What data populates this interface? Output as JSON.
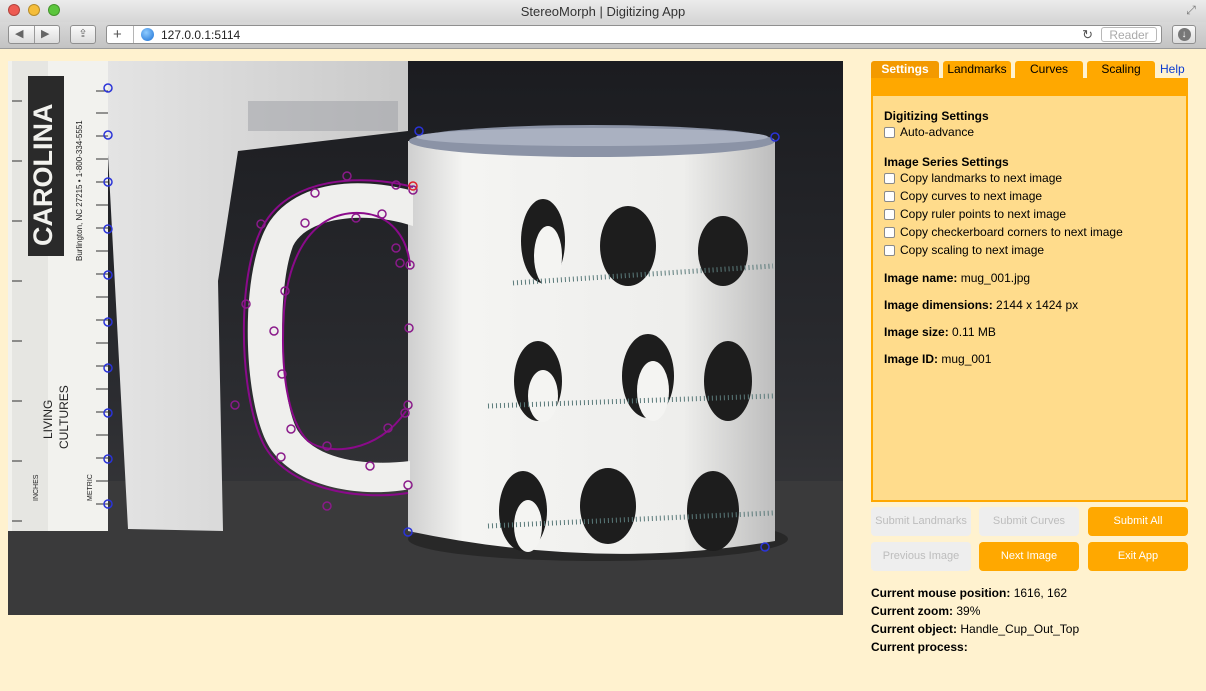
{
  "window": {
    "title": "StereoMorph | Digitizing App"
  },
  "browser": {
    "url": "127.0.0.1:5114",
    "reader_label": "Reader"
  },
  "tabs": [
    {
      "label": "Settings",
      "active": true
    },
    {
      "label": "Landmarks"
    },
    {
      "label": "Curves"
    },
    {
      "label": "Scaling"
    }
  ],
  "help_label": "Help",
  "settings": {
    "digitizing_title": "Digitizing Settings",
    "auto_advance": "Auto-advance",
    "series_title": "Image Series Settings",
    "options": [
      "Copy landmarks to next image",
      "Copy curves to next image",
      "Copy ruler points to next image",
      "Copy checkerboard corners to next image",
      "Copy scaling to next image"
    ],
    "image_name_label": "Image name:",
    "image_name": "mug_001.jpg",
    "image_dimensions_label": "Image dimensions:",
    "image_dimensions": "2144 x 1424 px",
    "image_size_label": "Image size:",
    "image_size": "0.11 MB",
    "image_id_label": "Image ID:",
    "image_id": "mug_001"
  },
  "buttons": {
    "submit_landmarks": "Submit Landmarks",
    "submit_curves": "Submit Curves",
    "submit_all": "Submit All",
    "previous_image": "Previous Image",
    "next_image": "Next Image",
    "exit_app": "Exit App"
  },
  "status": {
    "mouse_label": "Current mouse position:",
    "mouse_value": "1616, 162",
    "zoom_label": "Current zoom:",
    "zoom_value": "39%",
    "object_label": "Current object:",
    "object_value": "Handle_Cup_Out_Top",
    "process_label": "Current process:",
    "process_value": ""
  },
  "image_labels": {
    "ruler_brand": "CAROLINA",
    "ruler_sub": "Burlington, NC 27215 • 1-800-334-5551",
    "ruler_living": "LIVING",
    "ruler_cultures": "CULTURES",
    "ruler_inches": "INCHES",
    "ruler_metric": "METRIC"
  },
  "colors": {
    "accent": "#ffa800",
    "panel": "#ffdc8c",
    "page": "#fff2cf",
    "curve": "#8a0a8a",
    "landmark_blue": "#2a33d8"
  }
}
